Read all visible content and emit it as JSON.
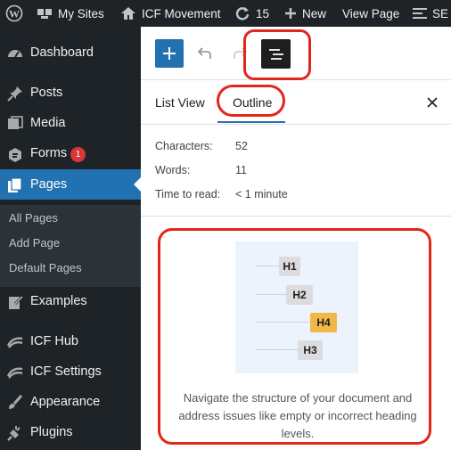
{
  "adminbar": {
    "wp_logo_icon": "wordpress-icon",
    "my_sites": "My Sites",
    "site_name": "ICF Movement",
    "updates_count": "15",
    "new_label": "New",
    "view_page": "View Page",
    "se_label": "SE"
  },
  "sidebar": {
    "dashboard": "Dashboard",
    "posts": "Posts",
    "media": "Media",
    "forms": "Forms",
    "forms_badge": "1",
    "pages": "Pages",
    "submenu": [
      "All Pages",
      "Add Page",
      "Default Pages"
    ],
    "examples": "Examples",
    "icf_hub": "ICF Hub",
    "icf_settings": "ICF Settings",
    "appearance": "Appearance",
    "plugins": "Plugins"
  },
  "panel": {
    "tab_list_view": "List View",
    "tab_outline": "Outline",
    "stats": {
      "characters_label": "Characters:",
      "characters_value": "52",
      "words_label": "Words:",
      "words_value": "11",
      "time_label": "Time to read:",
      "time_value": "< 1 minute"
    },
    "illustration": {
      "h1": "H1",
      "h2": "H2",
      "h4": "H4",
      "h3": "H3"
    },
    "description": "Navigate the structure of your document and address issues like empty or incorrect heading levels."
  },
  "colors": {
    "admin_bg": "#1d2327",
    "accent": "#2271b1",
    "highlight_h4": "#f0b849",
    "annotation": "#e2261c"
  }
}
